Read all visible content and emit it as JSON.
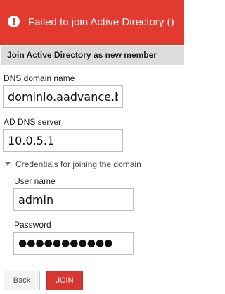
{
  "error": {
    "message": "Failed to join Active Directory ()"
  },
  "section": {
    "title": "Join Active Directory as new member"
  },
  "fields": {
    "dns_domain": {
      "label": "DNS domain name",
      "value": "dominio.aadvance.br"
    },
    "ad_dns_server": {
      "label": "AD DNS server",
      "value": "10.0.5.1"
    }
  },
  "credentials": {
    "toggle_label": "Credentials for joining the domain",
    "username": {
      "label": "User name",
      "value": "admin"
    },
    "password": {
      "label": "Password",
      "value": "●●●●●●●●●●●"
    }
  },
  "buttons": {
    "back": "Back",
    "join": "JOIN"
  },
  "colors": {
    "error_bg": "#e33a2f",
    "join_button": "#d6372e"
  }
}
